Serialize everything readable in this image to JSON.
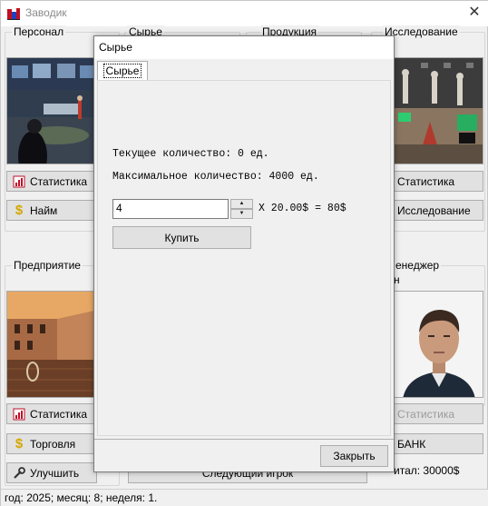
{
  "window": {
    "title": "Заводик",
    "close": "✕"
  },
  "groups": {
    "personnel": "Персонал",
    "raw": "Сырье",
    "products": "Продукция",
    "research": "Исследование",
    "enterprise": "Предприятие",
    "manager": "енеджер",
    "manager_name": "н"
  },
  "buttons": {
    "stats_personnel": "Статистика",
    "hire": "Найм",
    "stats_research": "Статистика",
    "research": "Исследование",
    "stats_enterprise": "Статистика",
    "trade": "Торговля",
    "upgrade": "Улучшить",
    "stats_manager": "Статистика",
    "bank": "БАНК",
    "next_player": "Следующий игрок"
  },
  "capital_label": "итал: 30000$",
  "status_bar": "год: 2025; месяц: 8; неделя: 1.",
  "dialog": {
    "title": "Сырье",
    "tab": "Сырье",
    "current_qty": "Текущее количество: 0 ед.",
    "max_qty": "Максимальное количество: 4000 ед.",
    "quantity_value": "4",
    "price_formula": "X 20.00$ = 80$",
    "buy": "Купить",
    "close": "Закрыть"
  },
  "colors": {
    "dollar": "#d4a800",
    "stats_icon": "#c0102a",
    "title_gray": "#8a8a8a"
  },
  "icons": {
    "stats": "stats-chart-icon",
    "money": "dollar-icon",
    "wrench": "wrench-icon"
  }
}
